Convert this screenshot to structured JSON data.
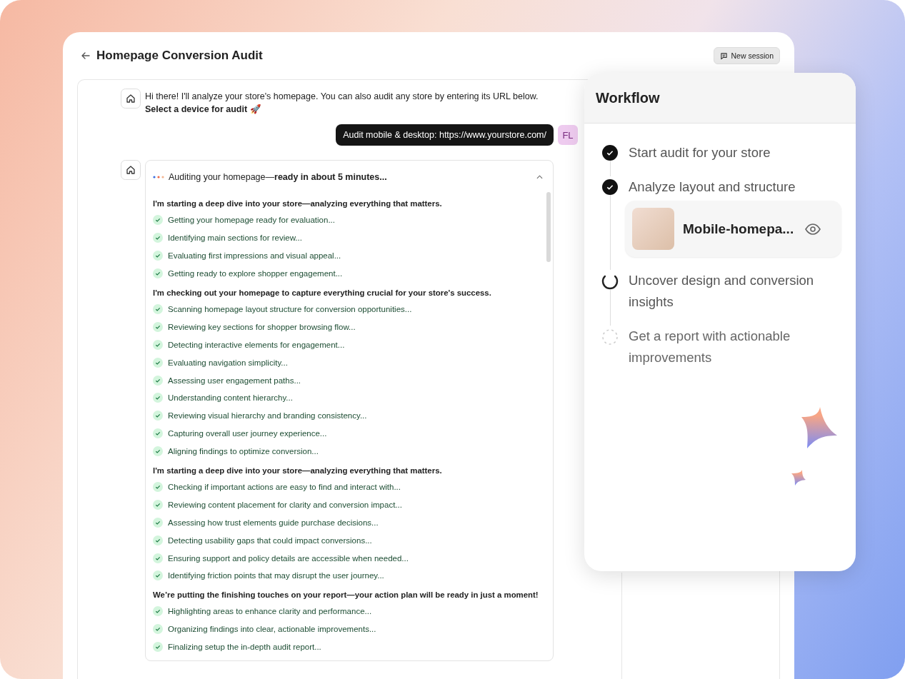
{
  "window": {
    "title": "Homepage Conversion Audit",
    "new_session_button": "New session"
  },
  "messages": [
    {
      "kind": "bot",
      "text": "Hi there! I'll analyze your store's homepage. You can also audit any store by entering its URL below.",
      "bold_line": "Select a device for audit 🚀"
    },
    {
      "kind": "user",
      "text": "Audit mobile & desktop: https://www.yourstore.com/",
      "avatar": "FL"
    }
  ],
  "audit": {
    "status": "Auditing your homepage—**ready in about 5 minutes...**",
    "expanded": true,
    "groups": [
      {
        "heading": "I'm starting a deep dive into your store—analyzing everything that matters.",
        "items": [
          {
            "text": "Getting your homepage ready for evaluation...",
            "done": true
          },
          {
            "text": "Identifying main sections for review...",
            "done": true
          },
          {
            "text": "Evaluating first impressions and visual appeal...",
            "done": true
          },
          {
            "text": "Getting ready to explore shopper engagement...",
            "done": true
          }
        ]
      },
      {
        "heading": "I'm checking out your homepage to capture everything crucial for your store's success.",
        "items": [
          {
            "text": "Scanning homepage layout structure for conversion opportunities...",
            "done": true
          },
          {
            "text": "Reviewing key sections for shopper browsing flow...",
            "done": true
          },
          {
            "text": "Detecting interactive elements for engagement...",
            "done": true
          },
          {
            "text": "Evaluating navigation simplicity...",
            "done": true
          },
          {
            "text": "Assessing user engagement paths...",
            "done": true
          },
          {
            "text": "Understanding content hierarchy...",
            "done": true
          },
          {
            "text": "Reviewing visual hierarchy and branding consistency...",
            "done": true
          },
          {
            "text": "Capturing overall user journey experience...",
            "done": true
          },
          {
            "text": "Aligning findings to optimize conversion...",
            "done": true
          }
        ]
      },
      {
        "heading": "I'm starting a deep dive into your store—analyzing everything that matters.",
        "items": [
          {
            "text": "Checking if important actions are easy to find and interact with...",
            "done": true
          },
          {
            "text": "Reviewing content placement for clarity and conversion impact...",
            "done": true
          },
          {
            "text": "Assessing how trust elements guide purchase decisions...",
            "done": true
          },
          {
            "text": "Detecting usability gaps that could impact conversions...",
            "done": true
          },
          {
            "text": "Ensuring support and policy details are accessible when needed...",
            "done": true
          },
          {
            "text": "Identifying friction points that may disrupt the user journey...",
            "done": true
          }
        ]
      },
      {
        "heading": "We’re putting the finishing touches on your report—your action plan will be ready in just a moment!",
        "items": [
          {
            "text": "Highlighting areas to enhance clarity and performance...",
            "done": true
          },
          {
            "text": "Organizing findings into clear, actionable improvements...",
            "done": true
          },
          {
            "text": "Finalizing setup the in-depth audit report...",
            "done": true
          }
        ]
      }
    ]
  },
  "workflow": {
    "title": "Workflow",
    "steps": [
      {
        "label": "Start audit for your store",
        "kind": "done"
      },
      {
        "label": "Analyze layout and structure",
        "kind": "done",
        "attachment": {
          "name": "Mobile-homepa..."
        }
      },
      {
        "label": "Uncover design and conversion insights",
        "kind": "running"
      },
      {
        "label": "Get a report with actionable improvements",
        "kind": "pending"
      }
    ]
  }
}
